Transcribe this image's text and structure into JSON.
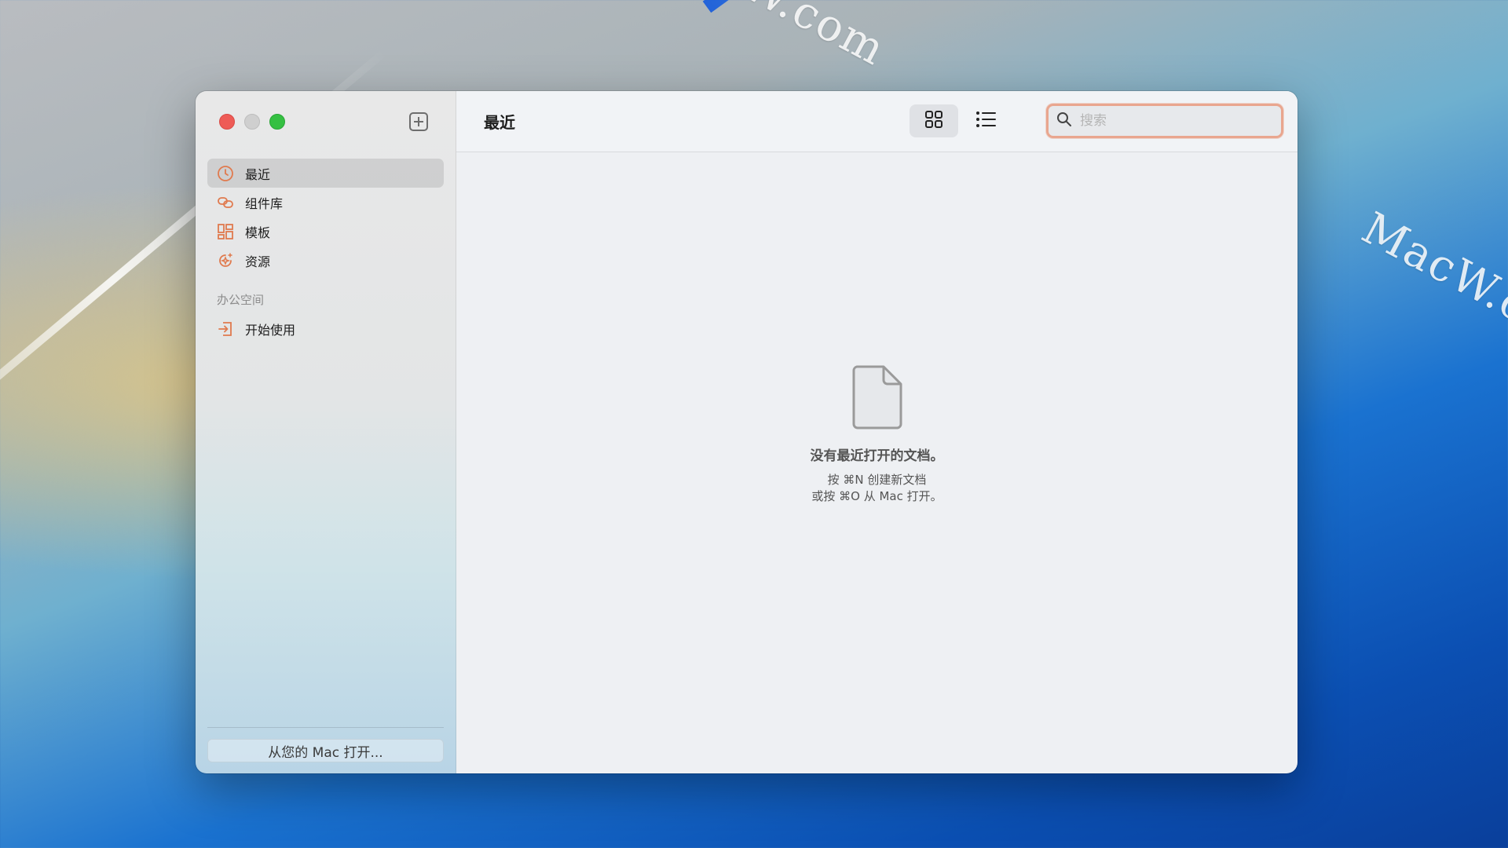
{
  "desktop": {
    "watermark": "MacW.com"
  },
  "window": {
    "sidebar": {
      "new_button_icon": "plus-square-icon",
      "items": [
        {
          "label": "最近",
          "icon": "clock-icon",
          "selected": true
        },
        {
          "label": "组件库",
          "icon": "link-shapes-icon",
          "selected": false
        },
        {
          "label": "模板",
          "icon": "grid-layout-icon",
          "selected": false
        },
        {
          "label": "资源",
          "icon": "sparkle-badge-icon",
          "selected": false
        }
      ],
      "section_label": "办公空间",
      "section_items": [
        {
          "label": "开始使用",
          "icon": "enter-icon"
        }
      ],
      "footer_button": "从您的 Mac 打开..."
    },
    "toolbar": {
      "title": "最近",
      "grid_view_icon": "grid-view-icon",
      "list_view_icon": "list-view-icon",
      "search_placeholder": "搜索"
    },
    "empty_state": {
      "title": "没有最近打开的文档。",
      "line1": "按 ⌘N 创建新文档",
      "line2": "或按 ⌘O 从 Mac 打开。"
    }
  },
  "colors": {
    "accent": "#e07a4e",
    "search_focus": "#e9a68f"
  }
}
